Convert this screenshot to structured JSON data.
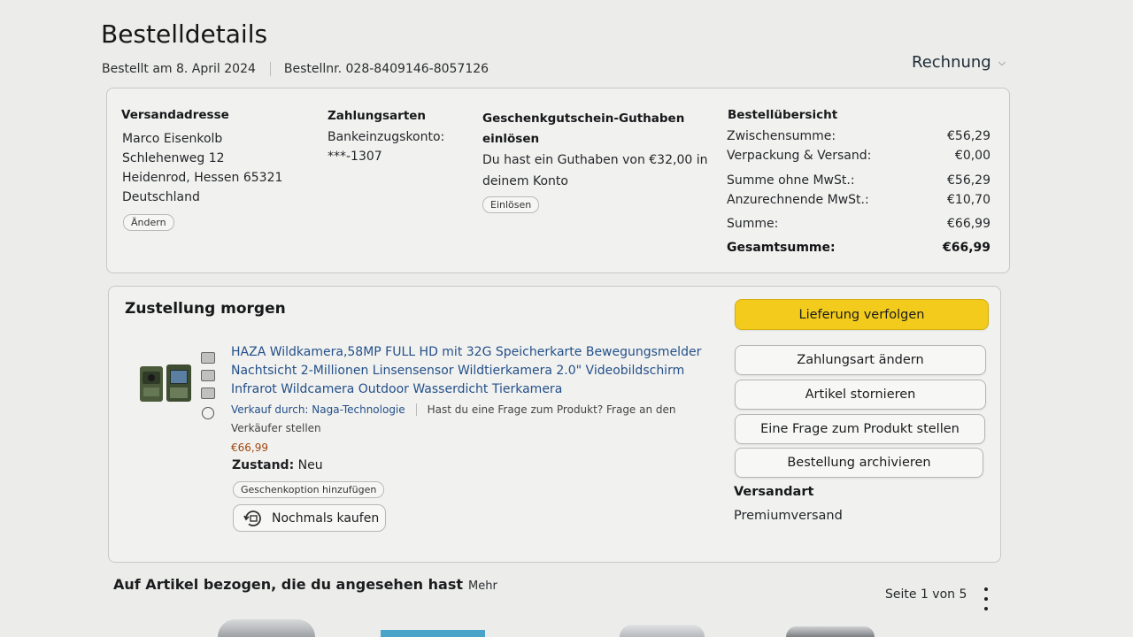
{
  "page": {
    "title": "Bestelldetails",
    "ordered_on": "Bestellt am 8. April 2024",
    "order_number": "Bestellnr. 028-8409146-8057126",
    "invoice_label": "Rechnung"
  },
  "shipping": {
    "heading": "Versandadresse",
    "lines": [
      "Marco Eisenkolb",
      "Schlehenweg 12",
      "Heidenrod, Hessen 65321",
      "Deutschland"
    ],
    "change_label": "Ändern"
  },
  "payment": {
    "heading": "Zahlungsarten",
    "method": "Bankeinzugskonto:",
    "account": "***-1307"
  },
  "giftcard": {
    "heading_line1": "Geschenkgutschein-Guthaben",
    "heading_line2": "einlösen",
    "text_line1": "Du hast ein Guthaben von €32,00 in",
    "text_line2": "deinem Konto",
    "redeem_label": "Einlösen"
  },
  "summary": {
    "heading": "Bestellübersicht",
    "rows": [
      {
        "label": "Zwischensumme:",
        "value": "€56,29"
      },
      {
        "label": "Verpackung & Versand:",
        "value": "€0,00"
      },
      {
        "label": "Summe ohne MwSt.:",
        "value": "€56,29"
      },
      {
        "label": "Anzurechnende MwSt.:",
        "value": "€10,70"
      },
      {
        "label": "Summe:",
        "value": "€66,99"
      }
    ],
    "total_label": "Gesamtsumme:",
    "total_value": "€66,99"
  },
  "delivery": {
    "heading": "Zustellung morgen",
    "product_title_lines": [
      "HAZA Wildkamera,58MP FULL HD mit 32G Speicherkarte Bewegungsmelder",
      "Nachtsicht 2-Millionen Linsensensor Wildtierkamera 2.0\" Videobildschirm",
      "Infrarot Wildcamera Outdoor Wasserdicht Tierkamera"
    ],
    "seller": "Verkauf durch: Naga-Technologie",
    "question_line1": "Hast du eine Frage zum Produkt? Frage an den",
    "question_line2": "Verkäufer stellen",
    "price": "€66,99",
    "condition_label": "Zustand:",
    "condition_value": "Neu",
    "gift_option_label": "Geschenkoption hinzufügen",
    "buy_again_label": "Nochmals kaufen"
  },
  "actions": {
    "track": "Lieferung verfolgen",
    "change_payment": "Zahlungsart ändern",
    "cancel": "Artikel stornieren",
    "ask_question": "Eine Frage zum Produkt stellen",
    "archive": "Bestellung archivieren",
    "shipping_type_heading": "Versandart",
    "shipping_type_value": "Premiumversand"
  },
  "related": {
    "title": "Auf Artikel bezogen, die du angesehen hast",
    "more": "Mehr",
    "page_indicator": "Seite 1 von 5"
  },
  "colors": {
    "primary_button": "#f2cb1c",
    "background": "#ecedea",
    "price": "#a0450e"
  }
}
